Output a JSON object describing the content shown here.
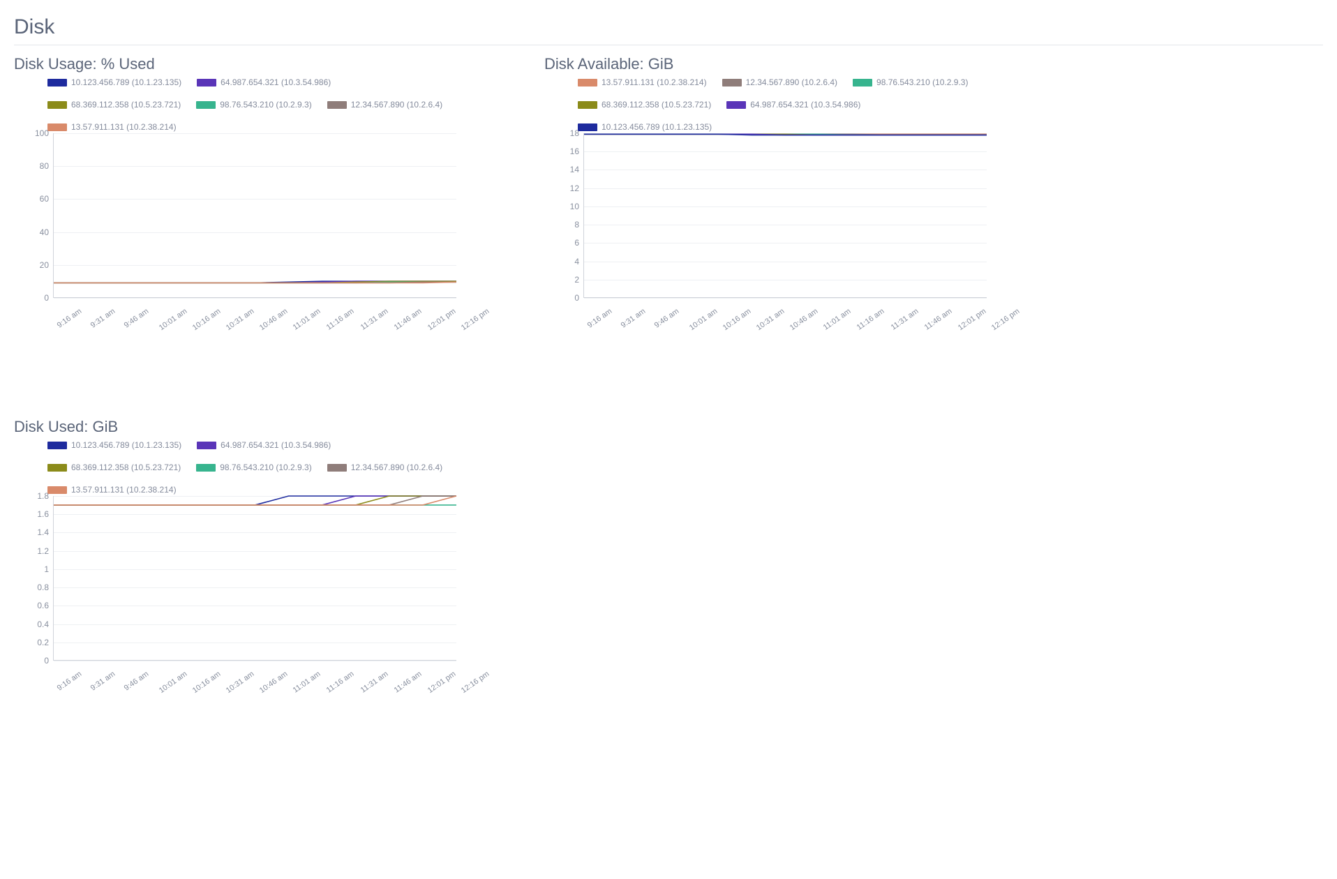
{
  "section_title": "Disk",
  "hosts": [
    {
      "id": "h1",
      "label": "10.123.456.789 (10.1.23.135)",
      "color": "#1e2b9e"
    },
    {
      "id": "h2",
      "label": "64.987.654.321 (10.3.54.986)",
      "color": "#5a35b8"
    },
    {
      "id": "h3",
      "label": "68.369.112.358 (10.5.23.721)",
      "color": "#8b8b1a"
    },
    {
      "id": "h4",
      "label": "98.76.543.210 (10.2.9.3)",
      "color": "#37b48e"
    },
    {
      "id": "h5",
      "label": "12.34.567.890 (10.2.6.4)",
      "color": "#8f7d7a"
    },
    {
      "id": "h6",
      "label": "13.57.911.131 (10.2.38.214)",
      "color": "#d98a6a"
    }
  ],
  "x_ticks": [
    "9:16 am",
    "9:31 am",
    "9:46 am",
    "10:01 am",
    "10:16 am",
    "10:31 am",
    "10:46 am",
    "11:01 am",
    "11:16 am",
    "11:31 am",
    "11:46 am",
    "12:01 pm",
    "12:16 pm"
  ],
  "chart_data": [
    {
      "id": "disk-usage-pct",
      "title": "Disk Usage: % Used",
      "type": "line",
      "legend_order": [
        "h1",
        "h2",
        "h3",
        "h4",
        "h5",
        "h6"
      ],
      "ylim": [
        0,
        100
      ],
      "yticks": [
        0,
        20,
        40,
        60,
        80,
        100
      ],
      "series": [
        {
          "host": "h1",
          "values": [
            8,
            8,
            8,
            8,
            8,
            8,
            8,
            8.5,
            9,
            9,
            9,
            9,
            9
          ]
        },
        {
          "host": "h2",
          "values": [
            8,
            8,
            8,
            8,
            8,
            8,
            8,
            8,
            8.5,
            9,
            9,
            9,
            9
          ]
        },
        {
          "host": "h3",
          "values": [
            8,
            8,
            8,
            8,
            8,
            8,
            8,
            8,
            8,
            8.5,
            9,
            9,
            9
          ]
        },
        {
          "host": "h4",
          "values": [
            8,
            8,
            8,
            8,
            8,
            8,
            8,
            8,
            8,
            8,
            8.5,
            8.5,
            8.5
          ]
        },
        {
          "host": "h5",
          "values": [
            8,
            8,
            8,
            8,
            8,
            8,
            8,
            8,
            8,
            8,
            8,
            8.5,
            8.5
          ]
        },
        {
          "host": "h6",
          "values": [
            8,
            8,
            8,
            8,
            8,
            8,
            8,
            8,
            8,
            8,
            8,
            8,
            8.5
          ]
        }
      ]
    },
    {
      "id": "disk-available",
      "title": "Disk Available: GiB",
      "type": "line",
      "legend_order": [
        "h6",
        "h5",
        "h4",
        "h3",
        "h2",
        "h1"
      ],
      "ylim": [
        0,
        18
      ],
      "yticks": [
        0,
        2,
        4,
        6,
        8,
        10,
        12,
        14,
        16,
        18
      ],
      "series": [
        {
          "host": "h6",
          "values": [
            17.9,
            17.9,
            17.9,
            17.9,
            17.9,
            17.9,
            17.9,
            17.9,
            17.9,
            17.9,
            17.9,
            17.9,
            17.9
          ]
        },
        {
          "host": "h5",
          "values": [
            17.9,
            17.9,
            17.9,
            17.9,
            17.9,
            17.9,
            17.9,
            17.9,
            17.9,
            17.8,
            17.8,
            17.8,
            17.8
          ]
        },
        {
          "host": "h4",
          "values": [
            17.9,
            17.9,
            17.9,
            17.9,
            17.9,
            17.9,
            17.9,
            17.9,
            17.8,
            17.8,
            17.8,
            17.8,
            17.8
          ]
        },
        {
          "host": "h3",
          "values": [
            17.9,
            17.9,
            17.9,
            17.9,
            17.9,
            17.9,
            17.9,
            17.8,
            17.8,
            17.8,
            17.8,
            17.8,
            17.8
          ]
        },
        {
          "host": "h2",
          "values": [
            17.9,
            17.9,
            17.9,
            17.9,
            17.9,
            17.9,
            17.8,
            17.8,
            17.8,
            17.8,
            17.8,
            17.8,
            17.8
          ]
        },
        {
          "host": "h1",
          "values": [
            17.9,
            17.9,
            17.9,
            17.9,
            17.9,
            17.8,
            17.8,
            17.8,
            17.8,
            17.8,
            17.8,
            17.8,
            17.8
          ]
        }
      ]
    },
    {
      "id": "disk-used",
      "title": "Disk Used: GiB",
      "type": "line",
      "legend_order": [
        "h1",
        "h2",
        "h3",
        "h4",
        "h5",
        "h6"
      ],
      "ylim": [
        0,
        1.8
      ],
      "yticks": [
        0,
        0.2,
        0.4,
        0.6,
        0.8,
        1.0,
        1.2,
        1.4,
        1.6,
        1.8
      ],
      "series": [
        {
          "host": "h1",
          "values": [
            1.7,
            1.7,
            1.7,
            1.7,
            1.7,
            1.7,
            1.7,
            1.8,
            1.8,
            1.8,
            1.8,
            1.8,
            1.8
          ]
        },
        {
          "host": "h2",
          "values": [
            1.7,
            1.7,
            1.7,
            1.7,
            1.7,
            1.7,
            1.7,
            1.7,
            1.7,
            1.8,
            1.8,
            1.8,
            1.8
          ]
        },
        {
          "host": "h3",
          "values": [
            1.7,
            1.7,
            1.7,
            1.7,
            1.7,
            1.7,
            1.7,
            1.7,
            1.7,
            1.7,
            1.8,
            1.8,
            1.8
          ]
        },
        {
          "host": "h4",
          "values": [
            1.7,
            1.7,
            1.7,
            1.7,
            1.7,
            1.7,
            1.7,
            1.7,
            1.7,
            1.7,
            1.7,
            1.7,
            1.7
          ]
        },
        {
          "host": "h5",
          "values": [
            1.7,
            1.7,
            1.7,
            1.7,
            1.7,
            1.7,
            1.7,
            1.7,
            1.7,
            1.7,
            1.7,
            1.8,
            1.8
          ]
        },
        {
          "host": "h6",
          "values": [
            1.7,
            1.7,
            1.7,
            1.7,
            1.7,
            1.7,
            1.7,
            1.7,
            1.7,
            1.7,
            1.7,
            1.7,
            1.8
          ]
        }
      ]
    }
  ]
}
